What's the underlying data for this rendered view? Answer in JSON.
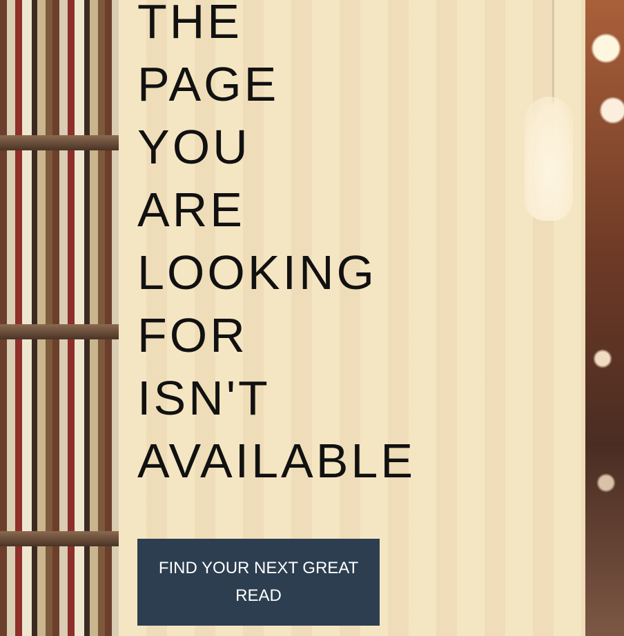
{
  "headline_lines": [
    "THE",
    "PAGE",
    "YOU",
    "ARE",
    "LOOKING",
    "FOR",
    "ISN'T",
    "AVAILABLE"
  ],
  "cta": {
    "label": "FIND YOUR NEXT GREAT READ"
  },
  "colors": {
    "panel": "#f5e6c3",
    "button": "#2c3e50",
    "button_text": "#ffffff",
    "headline_text": "#111111"
  }
}
